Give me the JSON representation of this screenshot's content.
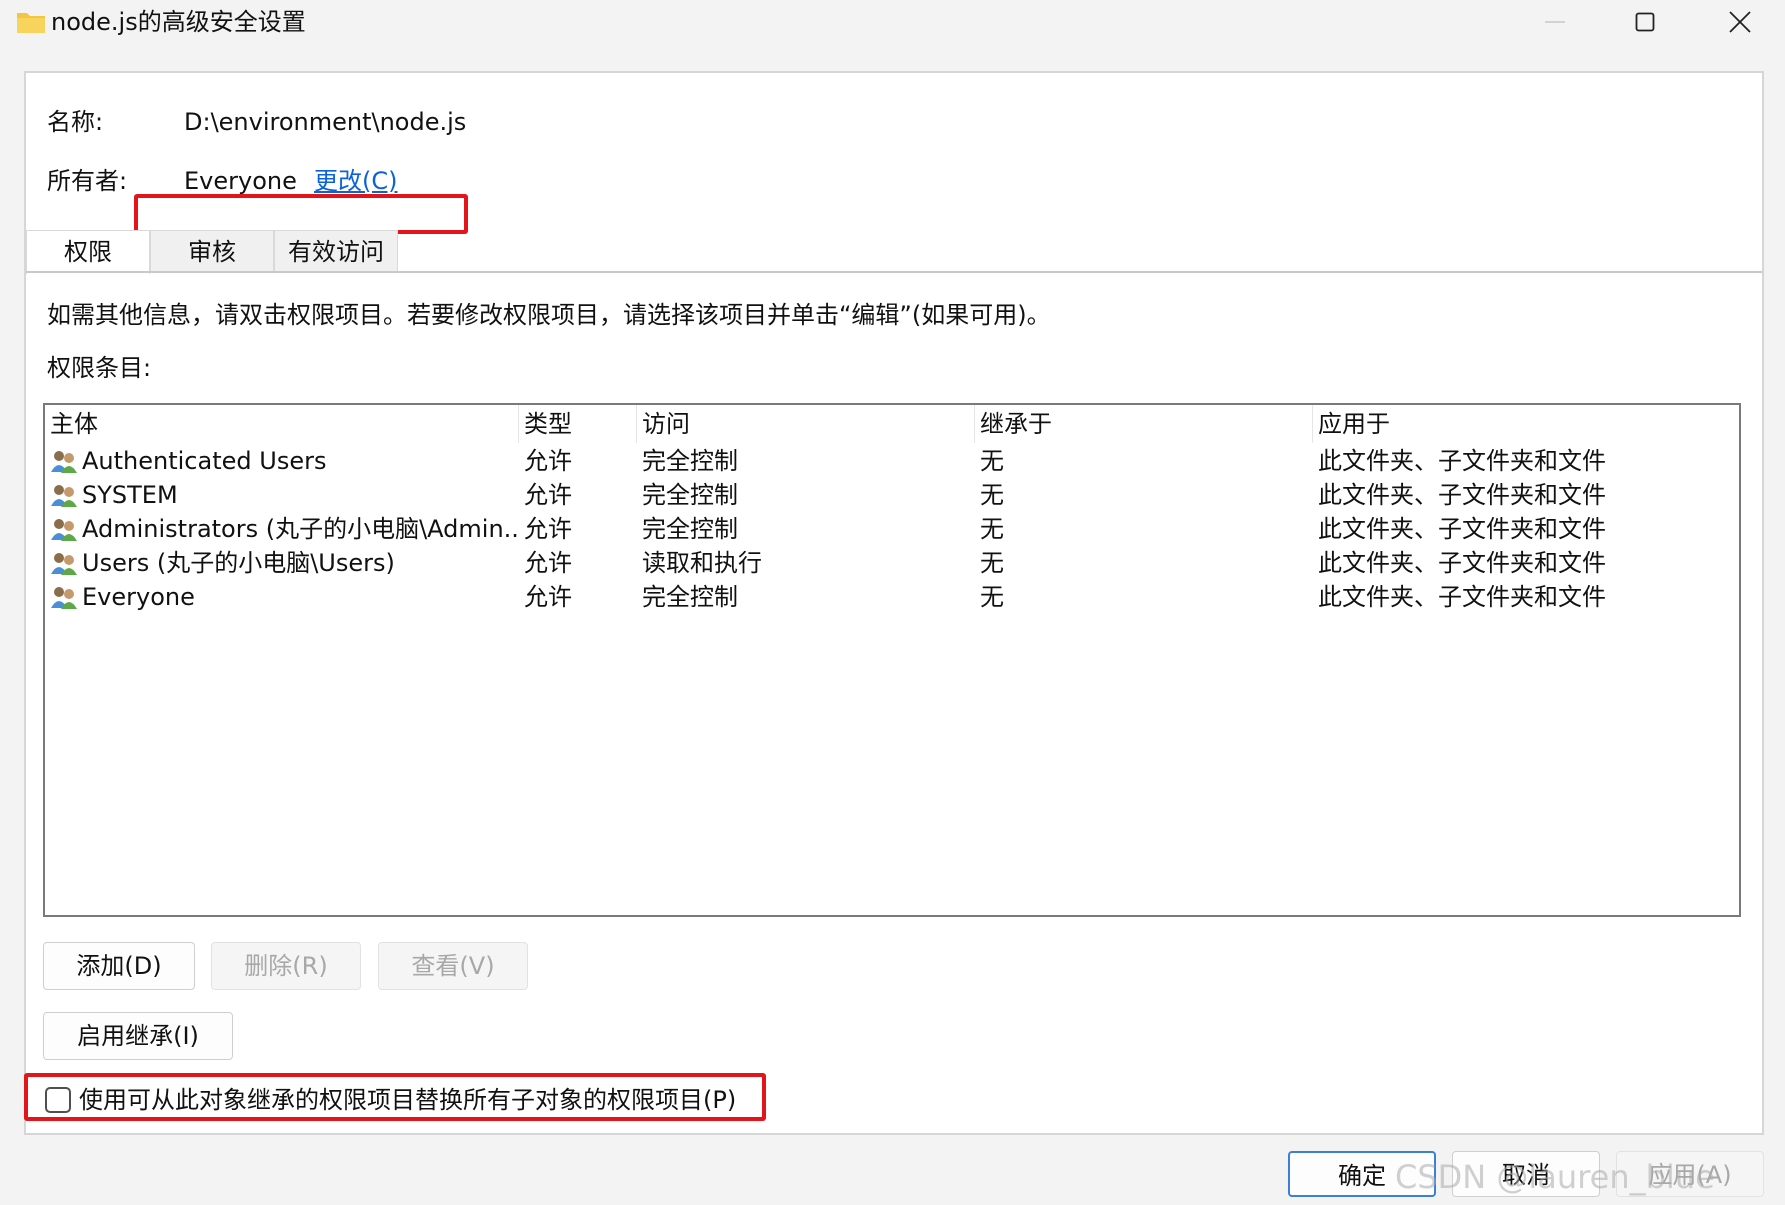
{
  "window": {
    "title": "node.js的高级安全设置"
  },
  "info": {
    "name_label": "名称:",
    "name_value": "D:\\environment\\node.js",
    "owner_label": "所有者:",
    "owner_value": "Everyone",
    "change_link": "更改(C)"
  },
  "tabs": [
    {
      "label": "权限"
    },
    {
      "label": "审核"
    },
    {
      "label": "有效访问"
    }
  ],
  "instructions": "如需其他信息，请双击权限项目。若要修改权限项目，请选择该项目并单击“编辑”(如果可用)。",
  "entries_label": "权限条目:",
  "list": {
    "columns": [
      "主体",
      "类型",
      "访问",
      "继承于",
      "应用于"
    ],
    "rows": [
      {
        "principal": "Authenticated Users",
        "type": "允许",
        "access": "完全控制",
        "inherited": "无",
        "applies": "此文件夹、子文件夹和文件"
      },
      {
        "principal": "SYSTEM",
        "type": "允许",
        "access": "完全控制",
        "inherited": "无",
        "applies": "此文件夹、子文件夹和文件"
      },
      {
        "principal": "Administrators (丸子的小电脑\\Admin...",
        "type": "允许",
        "access": "完全控制",
        "inherited": "无",
        "applies": "此文件夹、子文件夹和文件"
      },
      {
        "principal": "Users (丸子的小电脑\\Users)",
        "type": "允许",
        "access": "读取和执行",
        "inherited": "无",
        "applies": "此文件夹、子文件夹和文件"
      },
      {
        "principal": "Everyone",
        "type": "允许",
        "access": "完全控制",
        "inherited": "无",
        "applies": "此文件夹、子文件夹和文件"
      }
    ]
  },
  "buttons": {
    "add": "添加(D)",
    "remove": "删除(R)",
    "view": "查看(V)",
    "enable_inheritance": "启用继承(I)",
    "ok": "确定",
    "cancel": "取消",
    "apply": "应用(A)"
  },
  "checkbox": {
    "label": "使用可从此对象继承的权限项目替换所有子对象的权限项目(P)",
    "checked": false
  },
  "watermark": "CSDN @lauren_blue",
  "colors": {
    "highlight_box": "#e4141b",
    "link": "#0a64d8",
    "primary_border": "#3c7fd6"
  }
}
